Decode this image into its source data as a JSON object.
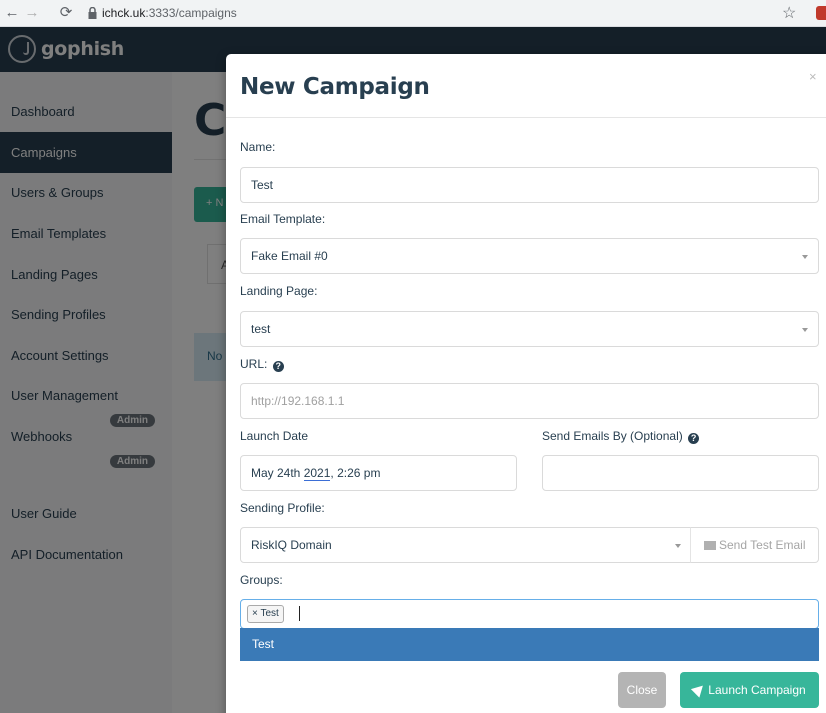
{
  "browser": {
    "url_host": "ichck.uk",
    "url_path": ":3333/campaigns"
  },
  "navbar": {
    "logo_text": "gophish"
  },
  "sidebar": {
    "items": [
      {
        "label": "Dashboard"
      },
      {
        "label": "Campaigns",
        "active": true
      },
      {
        "label": "Users & Groups"
      },
      {
        "label": "Email Templates"
      },
      {
        "label": "Landing Pages"
      },
      {
        "label": "Sending Profiles"
      },
      {
        "label": "Account Settings"
      },
      {
        "label": "User Management",
        "badge": "Admin"
      },
      {
        "label": "Webhooks",
        "badge": "Admin"
      },
      {
        "label": "User Guide"
      },
      {
        "label": "API Documentation"
      }
    ]
  },
  "background": {
    "title_fragment": "C",
    "new_button_fragment": "+ N",
    "tab_fragment": "A",
    "alert_fragment": "No"
  },
  "modal": {
    "title": "New Campaign",
    "close_glyph": "×",
    "name_label": "Name:",
    "name_value": "Test",
    "email_template_label": "Email Template:",
    "email_template_value": "Fake Email #0",
    "landing_page_label": "Landing Page:",
    "landing_page_value": "test",
    "url_label": "URL:",
    "url_placeholder": "http://192.168.1.1",
    "launch_date_label": "Launch Date",
    "launch_date_value_prefix": "May 24th ",
    "launch_date_value_year": "2021",
    "launch_date_value_suffix": ", 2:26 pm",
    "send_by_label": "Send Emails By (Optional)",
    "send_by_value": "",
    "sending_profile_label": "Sending Profile:",
    "sending_profile_value": "RiskIQ Domain",
    "send_test_email_label": "Send Test Email",
    "groups_label": "Groups:",
    "groups_tag_remove": "×",
    "groups_tag": "Test",
    "groups_dropdown_option": "Test",
    "close_button": "Close",
    "launch_button": "Launch Campaign"
  },
  "colors": {
    "navbar": "#283f50",
    "accent_green": "#37b69a",
    "dropdown_highlight": "#3a7ab7"
  }
}
